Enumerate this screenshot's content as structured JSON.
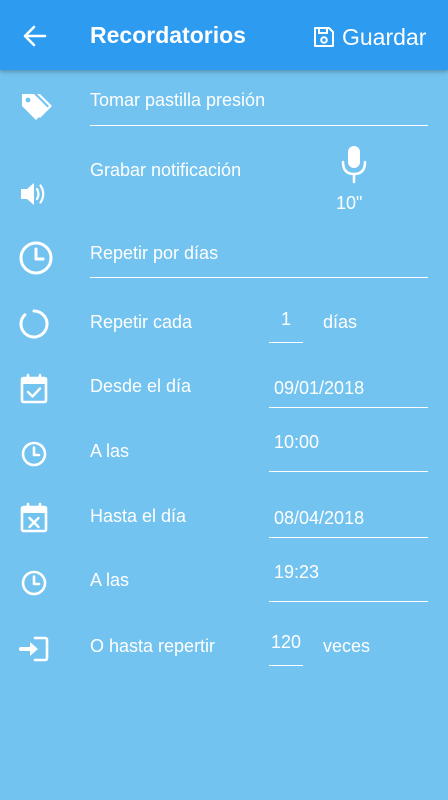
{
  "appbar": {
    "title": "Recordatorios",
    "save_label": "Guardar"
  },
  "form": {
    "reminder_name": "Tomar pastilla presión",
    "record_label": "Grabar notificación",
    "record_duration": "10\"",
    "repeat_days_label": "Repetir por días",
    "repeat_every_label": "Repetir cada",
    "repeat_every_value": "1",
    "repeat_every_unit": "días",
    "from_label": "Desde el día",
    "from_date": "09/01/2018",
    "from_time_label": "A las",
    "from_time": "10:00",
    "until_label": "Hasta el día",
    "until_date": "08/04/2018",
    "until_time_label": "A las",
    "until_time": "19:23",
    "or_until_label": "O hasta repertir",
    "or_until_value": "120",
    "or_until_unit": "veces"
  },
  "colors": {
    "background": "#73c3f0",
    "appbar": "#2d9bf0",
    "foreground": "#ffffff"
  }
}
